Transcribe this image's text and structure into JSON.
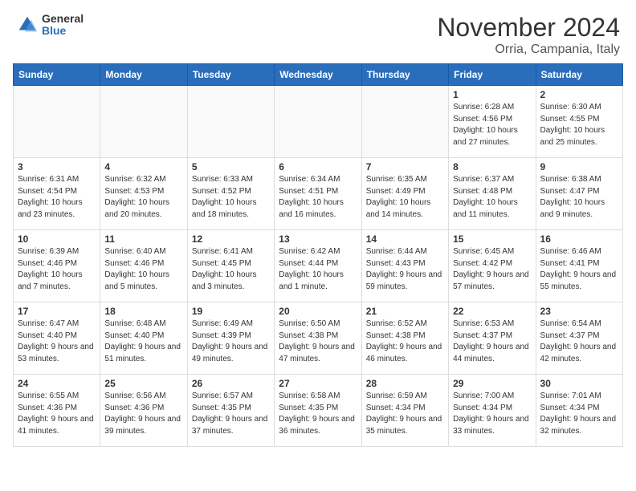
{
  "logo": {
    "general": "General",
    "blue": "Blue"
  },
  "header": {
    "month": "November 2024",
    "location": "Orria, Campania, Italy"
  },
  "weekdays": [
    "Sunday",
    "Monday",
    "Tuesday",
    "Wednesday",
    "Thursday",
    "Friday",
    "Saturday"
  ],
  "weeks": [
    [
      {
        "day": "",
        "text": "",
        "empty": true
      },
      {
        "day": "",
        "text": "",
        "empty": true
      },
      {
        "day": "",
        "text": "",
        "empty": true
      },
      {
        "day": "",
        "text": "",
        "empty": true
      },
      {
        "day": "",
        "text": "",
        "empty": true
      },
      {
        "day": "1",
        "text": "Sunrise: 6:28 AM\nSunset: 4:56 PM\nDaylight: 10 hours and 27 minutes."
      },
      {
        "day": "2",
        "text": "Sunrise: 6:30 AM\nSunset: 4:55 PM\nDaylight: 10 hours and 25 minutes."
      }
    ],
    [
      {
        "day": "3",
        "text": "Sunrise: 6:31 AM\nSunset: 4:54 PM\nDaylight: 10 hours and 23 minutes."
      },
      {
        "day": "4",
        "text": "Sunrise: 6:32 AM\nSunset: 4:53 PM\nDaylight: 10 hours and 20 minutes."
      },
      {
        "day": "5",
        "text": "Sunrise: 6:33 AM\nSunset: 4:52 PM\nDaylight: 10 hours and 18 minutes."
      },
      {
        "day": "6",
        "text": "Sunrise: 6:34 AM\nSunset: 4:51 PM\nDaylight: 10 hours and 16 minutes."
      },
      {
        "day": "7",
        "text": "Sunrise: 6:35 AM\nSunset: 4:49 PM\nDaylight: 10 hours and 14 minutes."
      },
      {
        "day": "8",
        "text": "Sunrise: 6:37 AM\nSunset: 4:48 PM\nDaylight: 10 hours and 11 minutes."
      },
      {
        "day": "9",
        "text": "Sunrise: 6:38 AM\nSunset: 4:47 PM\nDaylight: 10 hours and 9 minutes."
      }
    ],
    [
      {
        "day": "10",
        "text": "Sunrise: 6:39 AM\nSunset: 4:46 PM\nDaylight: 10 hours and 7 minutes."
      },
      {
        "day": "11",
        "text": "Sunrise: 6:40 AM\nSunset: 4:46 PM\nDaylight: 10 hours and 5 minutes."
      },
      {
        "day": "12",
        "text": "Sunrise: 6:41 AM\nSunset: 4:45 PM\nDaylight: 10 hours and 3 minutes."
      },
      {
        "day": "13",
        "text": "Sunrise: 6:42 AM\nSunset: 4:44 PM\nDaylight: 10 hours and 1 minute."
      },
      {
        "day": "14",
        "text": "Sunrise: 6:44 AM\nSunset: 4:43 PM\nDaylight: 9 hours and 59 minutes."
      },
      {
        "day": "15",
        "text": "Sunrise: 6:45 AM\nSunset: 4:42 PM\nDaylight: 9 hours and 57 minutes."
      },
      {
        "day": "16",
        "text": "Sunrise: 6:46 AM\nSunset: 4:41 PM\nDaylight: 9 hours and 55 minutes."
      }
    ],
    [
      {
        "day": "17",
        "text": "Sunrise: 6:47 AM\nSunset: 4:40 PM\nDaylight: 9 hours and 53 minutes."
      },
      {
        "day": "18",
        "text": "Sunrise: 6:48 AM\nSunset: 4:40 PM\nDaylight: 9 hours and 51 minutes."
      },
      {
        "day": "19",
        "text": "Sunrise: 6:49 AM\nSunset: 4:39 PM\nDaylight: 9 hours and 49 minutes."
      },
      {
        "day": "20",
        "text": "Sunrise: 6:50 AM\nSunset: 4:38 PM\nDaylight: 9 hours and 47 minutes."
      },
      {
        "day": "21",
        "text": "Sunrise: 6:52 AM\nSunset: 4:38 PM\nDaylight: 9 hours and 46 minutes."
      },
      {
        "day": "22",
        "text": "Sunrise: 6:53 AM\nSunset: 4:37 PM\nDaylight: 9 hours and 44 minutes."
      },
      {
        "day": "23",
        "text": "Sunrise: 6:54 AM\nSunset: 4:37 PM\nDaylight: 9 hours and 42 minutes."
      }
    ],
    [
      {
        "day": "24",
        "text": "Sunrise: 6:55 AM\nSunset: 4:36 PM\nDaylight: 9 hours and 41 minutes."
      },
      {
        "day": "25",
        "text": "Sunrise: 6:56 AM\nSunset: 4:36 PM\nDaylight: 9 hours and 39 minutes."
      },
      {
        "day": "26",
        "text": "Sunrise: 6:57 AM\nSunset: 4:35 PM\nDaylight: 9 hours and 37 minutes."
      },
      {
        "day": "27",
        "text": "Sunrise: 6:58 AM\nSunset: 4:35 PM\nDaylight: 9 hours and 36 minutes."
      },
      {
        "day": "28",
        "text": "Sunrise: 6:59 AM\nSunset: 4:34 PM\nDaylight: 9 hours and 35 minutes."
      },
      {
        "day": "29",
        "text": "Sunrise: 7:00 AM\nSunset: 4:34 PM\nDaylight: 9 hours and 33 minutes."
      },
      {
        "day": "30",
        "text": "Sunrise: 7:01 AM\nSunset: 4:34 PM\nDaylight: 9 hours and 32 minutes."
      }
    ]
  ]
}
